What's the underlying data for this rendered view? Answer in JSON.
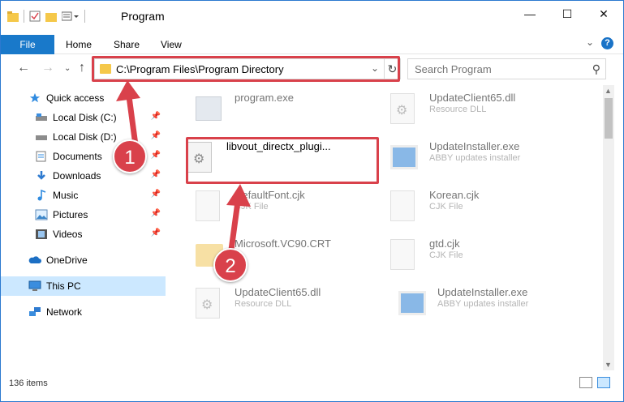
{
  "window": {
    "title": "Program",
    "controls": {
      "minimize": "—",
      "maximize": "☐",
      "close": "✕"
    }
  },
  "ribbon": {
    "tabs": [
      {
        "label": "File"
      },
      {
        "label": "Home"
      },
      {
        "label": "Share"
      },
      {
        "label": "View"
      }
    ],
    "help": "?"
  },
  "address": {
    "path": "C:\\Program Files\\Program Directory",
    "search_placeholder": "Search Program"
  },
  "nav": {
    "items": [
      {
        "label": "Quick access",
        "icon": "star-icon"
      },
      {
        "label": "Local Disk (C:)",
        "icon": "drive-icon",
        "pinned": true
      },
      {
        "label": "Local Disk (D:)",
        "icon": "drive-icon",
        "pinned": true
      },
      {
        "label": "Documents",
        "icon": "documents-icon",
        "pinned": true
      },
      {
        "label": "Downloads",
        "icon": "downloads-icon",
        "pinned": true
      },
      {
        "label": "Music",
        "icon": "music-icon",
        "pinned": true
      },
      {
        "label": "Pictures",
        "icon": "pictures-icon",
        "pinned": true
      },
      {
        "label": "Videos",
        "icon": "videos-icon",
        "pinned": true
      },
      {
        "label": "OneDrive",
        "icon": "cloud-icon"
      },
      {
        "label": "This PC",
        "icon": "computer-icon",
        "selected": true
      },
      {
        "label": "Network",
        "icon": "network-icon"
      }
    ]
  },
  "files": [
    {
      "name": "program.exe",
      "type": ""
    },
    {
      "name": "UpdateClient65.dll",
      "type": "Resource DLL"
    },
    {
      "name": "libvout_directx_plugi...",
      "type": ""
    },
    {
      "name": "UpdateInstaller.exe",
      "type": "ABBY updates installer"
    },
    {
      "name": "DefaultFont.cjk",
      "type": "CJK File"
    },
    {
      "name": "Korean.cjk",
      "type": "CJK File"
    },
    {
      "name": "Microsoft.VC90.CRT",
      "type": ""
    },
    {
      "name": "gtd.cjk",
      "type": "CJK File"
    },
    {
      "name": "UpdateClient65.dll",
      "type": "Resource DLL"
    },
    {
      "name": "UpdateInstaller.exe",
      "type": "ABBY updates installer"
    }
  ],
  "callouts": {
    "first": "1",
    "second": "2"
  },
  "status": {
    "count": "136 items"
  },
  "colors": {
    "accent": "#1979ca",
    "highlight": "#d9414b",
    "selected_bg": "#cce8ff"
  }
}
